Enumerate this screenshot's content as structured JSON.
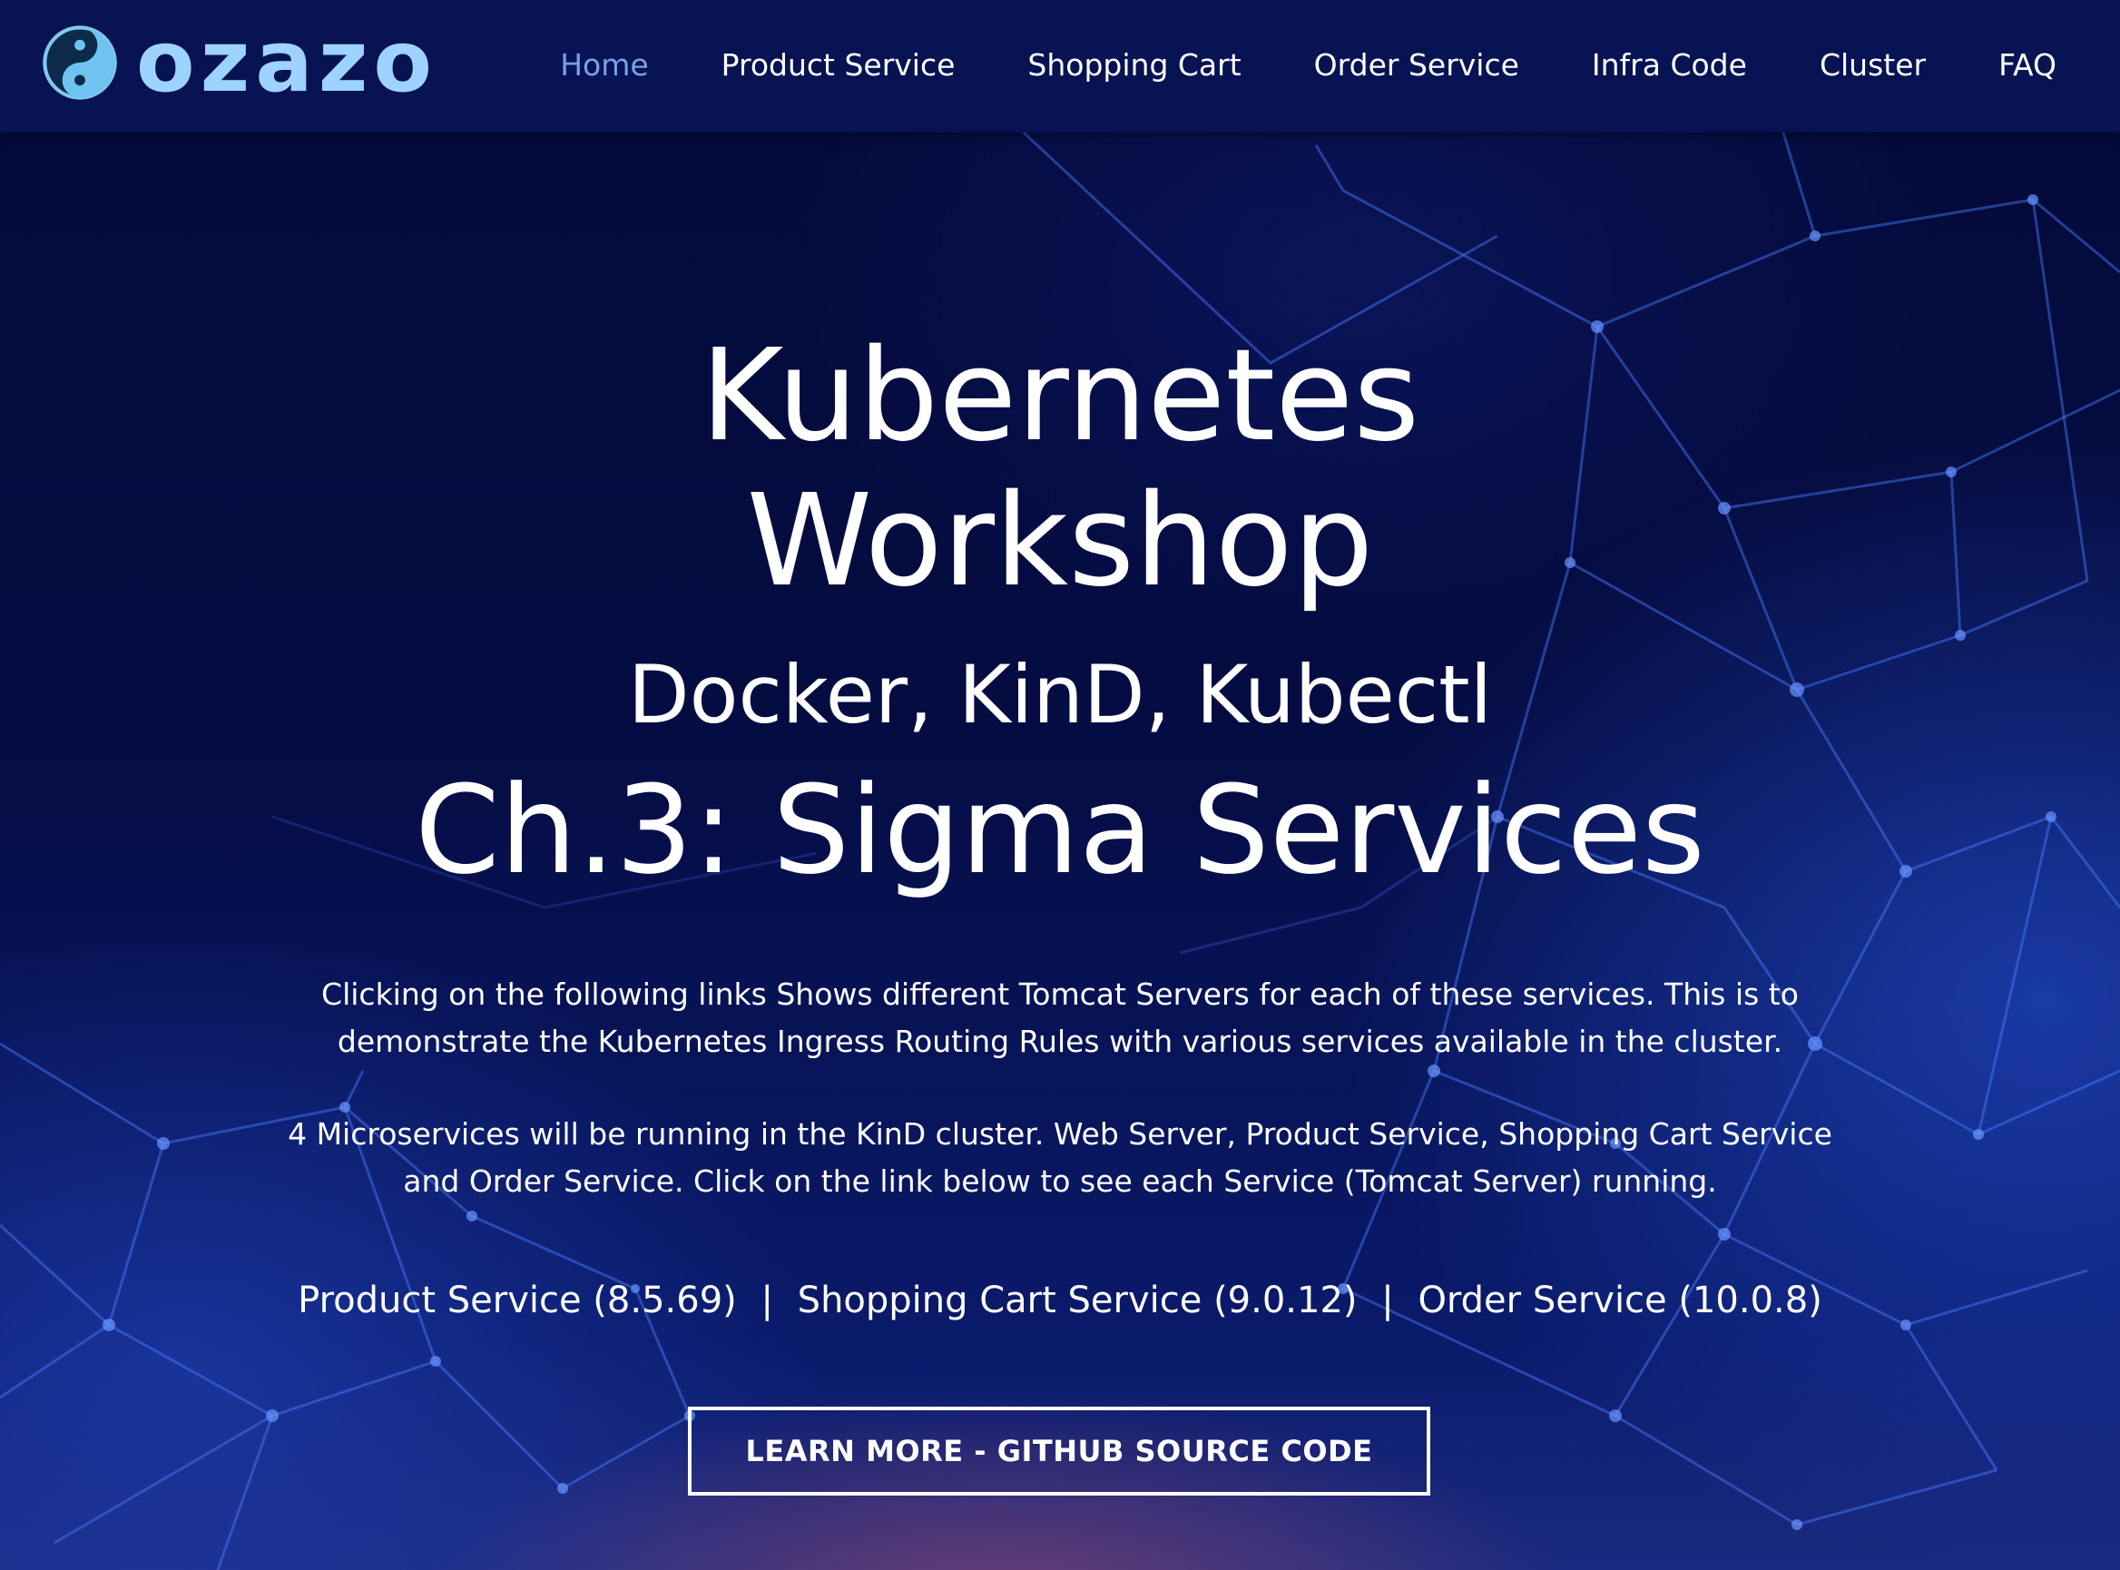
{
  "brand": {
    "name": "ozazo",
    "logo_icon": "yin-yang-icon"
  },
  "nav": {
    "items": [
      {
        "label": "Home",
        "active": true
      },
      {
        "label": "Product Service",
        "active": false
      },
      {
        "label": "Shopping Cart",
        "active": false
      },
      {
        "label": "Order Service",
        "active": false
      },
      {
        "label": "Infra Code",
        "active": false
      },
      {
        "label": "Cluster",
        "active": false
      },
      {
        "label": "FAQ",
        "active": false
      }
    ]
  },
  "hero": {
    "title_line1": "Kubernetes",
    "title_line2": "Workshop",
    "subtitle": "Docker, KinD, Kubectl",
    "chapter": "Ch.3: Sigma Services",
    "paragraph1_line1": "Clicking  on the following links Shows different Tomcat Servers for each of these services. This is to",
    "paragraph1_line2": "demonstrate the Kubernetes Ingress Routing Rules with various services available in the cluster.",
    "paragraph2_line1": "4 Microservices will be running in the KinD cluster.  Web Server, Product Service, Shopping Cart Service",
    "paragraph2_line2": "and Order Service. Click on the link below to see each Service (Tomcat Server) running.",
    "links": [
      {
        "label": "Product Service (8.5.69)"
      },
      {
        "label": "Shopping Cart Service (9.0.12)"
      },
      {
        "label": "Order Service (10.0.8)"
      }
    ],
    "link_separator": "|",
    "cta_label": "LEARN MORE - GITHUB SOURCE CODE"
  },
  "colors": {
    "header_bg": "#071352",
    "page_bg": "#060d3f",
    "nav_active": "#7aa0e8",
    "logo_text": "#9ed3ff",
    "network_lines": "#4a7cff"
  }
}
